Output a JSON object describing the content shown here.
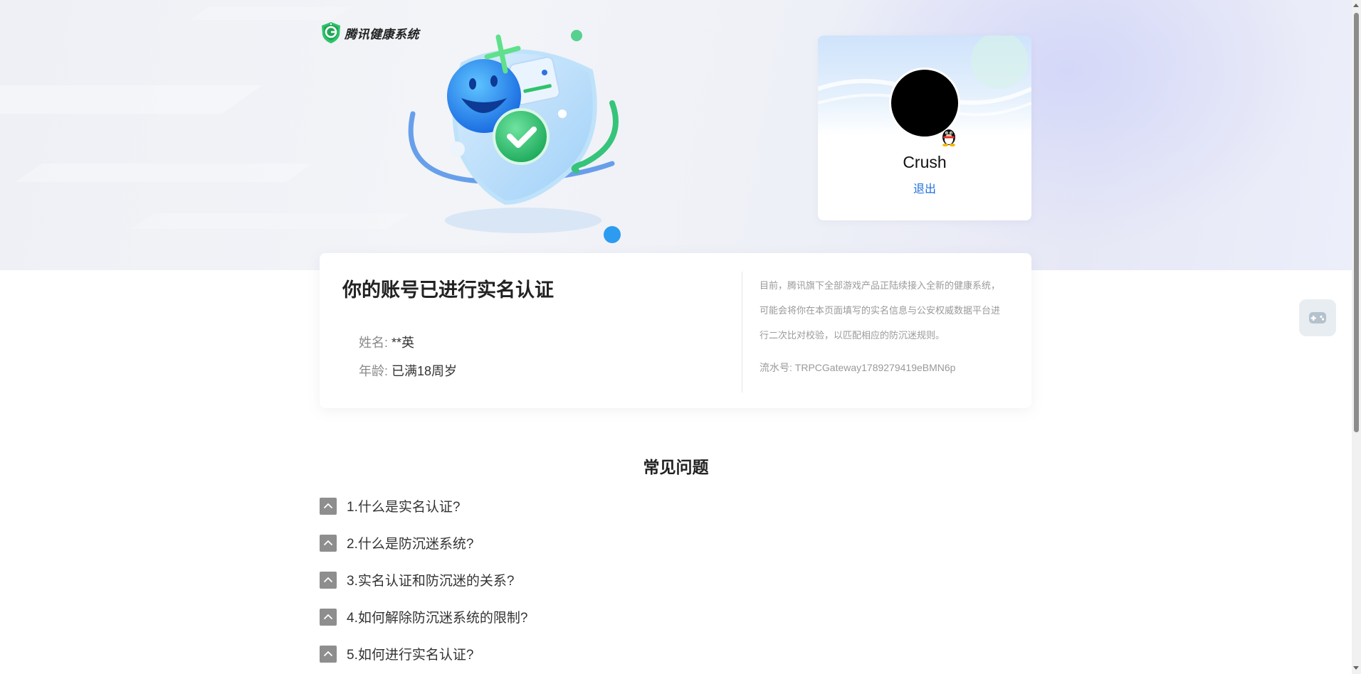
{
  "brand": {
    "logo_text": "腾讯健康系统",
    "logo_icon": "tencent-health-shield-icon",
    "accent_color": "#2ec36b"
  },
  "profile": {
    "nickname": "Crush",
    "logout_label": "退出",
    "login_badge_icon": "qq-penguin-icon",
    "link_color": "#1f6fdc"
  },
  "verification": {
    "title": "你的账号已进行实名认证",
    "fields": [
      {
        "label": "姓名:",
        "value": "**英"
      },
      {
        "label": "年龄:",
        "value": "已满18周岁"
      }
    ],
    "notice": "目前，腾讯旗下全部游戏产品正陆续接入全新的健康系统，可能会将你在本页面填写的实名信息与公安权威数据平台进行二次比对校验，以匹配相应的防沉迷规则。",
    "serial_label": "流水号:",
    "serial_value": "TRPCGateway1789279419eBMN6p"
  },
  "faq": {
    "title": "常见问题",
    "items": [
      {
        "question": "1.什么是实名认证?"
      },
      {
        "question": "2.什么是防沉迷系统?"
      },
      {
        "question": "3.实名认证和防沉迷的关系?"
      },
      {
        "question": "4.如何解除防沉迷系统的限制?"
      },
      {
        "question": "5.如何进行实名认证?"
      }
    ],
    "toggle_icon": "chevron-up-icon"
  },
  "side": {
    "float_icon": "game-controller-icon"
  }
}
